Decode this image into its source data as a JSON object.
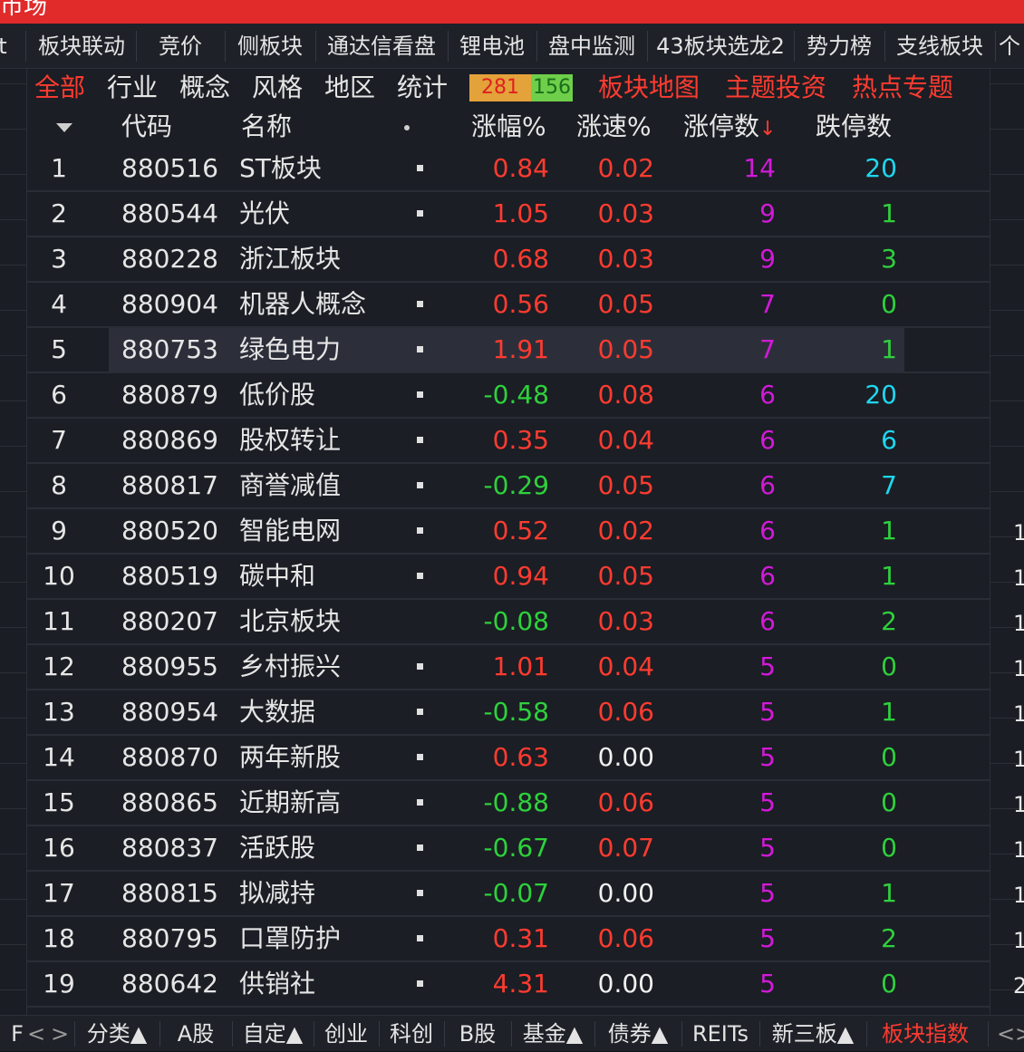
{
  "window": {
    "title": "市场"
  },
  "top_tabs": [
    {
      "label": "t"
    },
    {
      "label": "板块联动"
    },
    {
      "label": "竞价"
    },
    {
      "label": "侧板块"
    },
    {
      "label": "通达信看盘"
    },
    {
      "label": "锂电池"
    },
    {
      "label": "盘中监测"
    },
    {
      "label": "43板块选龙2"
    },
    {
      "label": "势力榜"
    },
    {
      "label": "支线板块"
    },
    {
      "label": "个"
    }
  ],
  "filters": [
    {
      "label": "全部",
      "active": true
    },
    {
      "label": "行业",
      "active": false
    },
    {
      "label": "概念",
      "active": false
    },
    {
      "label": "风格",
      "active": false
    },
    {
      "label": "地区",
      "active": false
    },
    {
      "label": "统计",
      "active": false
    }
  ],
  "counter": {
    "up": "281",
    "down": "156"
  },
  "hot_links": [
    {
      "label": "板块地图"
    },
    {
      "label": "主题投资"
    },
    {
      "label": "热点专题"
    }
  ],
  "columns": {
    "code": "代码",
    "name": "名称",
    "pct": "涨幅%",
    "speed": "涨速%",
    "limit_up": "涨停数",
    "limit_up_sort": "↓",
    "limit_down": "跌停数"
  },
  "rows": [
    {
      "idx": "1",
      "code": "880516",
      "name": "ST板块",
      "mark": true,
      "pct": "0.84",
      "pct_color": "red",
      "speed": "0.02",
      "speed_color": "red",
      "limit_up": "14",
      "limit_down": "20",
      "dn_color": "cyan"
    },
    {
      "idx": "2",
      "code": "880544",
      "name": "光伏",
      "mark": true,
      "pct": "1.05",
      "pct_color": "red",
      "speed": "0.03",
      "speed_color": "red",
      "limit_up": "9",
      "limit_down": "1",
      "dn_color": "green"
    },
    {
      "idx": "3",
      "code": "880228",
      "name": "浙江板块",
      "mark": false,
      "pct": "0.68",
      "pct_color": "red",
      "speed": "0.03",
      "speed_color": "red",
      "limit_up": "9",
      "limit_down": "3",
      "dn_color": "green"
    },
    {
      "idx": "4",
      "code": "880904",
      "name": "机器人概念",
      "mark": true,
      "pct": "0.56",
      "pct_color": "red",
      "speed": "0.05",
      "speed_color": "red",
      "limit_up": "7",
      "limit_down": "0",
      "dn_color": "green"
    },
    {
      "idx": "5",
      "code": "880753",
      "name": "绿色电力",
      "mark": true,
      "pct": "1.91",
      "pct_color": "red",
      "speed": "0.05",
      "speed_color": "red",
      "limit_up": "7",
      "limit_down": "1",
      "dn_color": "green",
      "selected": true
    },
    {
      "idx": "6",
      "code": "880879",
      "name": "低价股",
      "mark": true,
      "pct": "-0.48",
      "pct_color": "green",
      "speed": "0.08",
      "speed_color": "red",
      "limit_up": "6",
      "limit_down": "20",
      "dn_color": "cyan"
    },
    {
      "idx": "7",
      "code": "880869",
      "name": "股权转让",
      "mark": true,
      "pct": "0.35",
      "pct_color": "red",
      "speed": "0.04",
      "speed_color": "red",
      "limit_up": "6",
      "limit_down": "6",
      "dn_color": "cyan"
    },
    {
      "idx": "8",
      "code": "880817",
      "name": "商誉减值",
      "mark": true,
      "pct": "-0.29",
      "pct_color": "green",
      "speed": "0.05",
      "speed_color": "red",
      "limit_up": "6",
      "limit_down": "7",
      "dn_color": "cyan"
    },
    {
      "idx": "9",
      "code": "880520",
      "name": "智能电网",
      "mark": true,
      "pct": "0.52",
      "pct_color": "red",
      "speed": "0.02",
      "speed_color": "red",
      "limit_up": "6",
      "limit_down": "1",
      "dn_color": "green"
    },
    {
      "idx": "10",
      "code": "880519",
      "name": "碳中和",
      "mark": true,
      "pct": "0.94",
      "pct_color": "red",
      "speed": "0.05",
      "speed_color": "red",
      "limit_up": "6",
      "limit_down": "1",
      "dn_color": "green"
    },
    {
      "idx": "11",
      "code": "880207",
      "name": "北京板块",
      "mark": false,
      "pct": "-0.08",
      "pct_color": "green",
      "speed": "0.03",
      "speed_color": "red",
      "limit_up": "6",
      "limit_down": "2",
      "dn_color": "green"
    },
    {
      "idx": "12",
      "code": "880955",
      "name": "乡村振兴",
      "mark": true,
      "pct": "1.01",
      "pct_color": "red",
      "speed": "0.04",
      "speed_color": "red",
      "limit_up": "5",
      "limit_down": "0",
      "dn_color": "green"
    },
    {
      "idx": "13",
      "code": "880954",
      "name": "大数据",
      "mark": true,
      "pct": "-0.58",
      "pct_color": "green",
      "speed": "0.06",
      "speed_color": "red",
      "limit_up": "5",
      "limit_down": "1",
      "dn_color": "green"
    },
    {
      "idx": "14",
      "code": "880870",
      "name": "两年新股",
      "mark": true,
      "pct": "0.63",
      "pct_color": "red",
      "speed": "0.00",
      "speed_color": "white",
      "limit_up": "5",
      "limit_down": "0",
      "dn_color": "green"
    },
    {
      "idx": "15",
      "code": "880865",
      "name": "近期新高",
      "mark": true,
      "pct": "-0.88",
      "pct_color": "green",
      "speed": "0.06",
      "speed_color": "red",
      "limit_up": "5",
      "limit_down": "0",
      "dn_color": "green"
    },
    {
      "idx": "16",
      "code": "880837",
      "name": "活跃股",
      "mark": true,
      "pct": "-0.67",
      "pct_color": "green",
      "speed": "0.07",
      "speed_color": "red",
      "limit_up": "5",
      "limit_down": "0",
      "dn_color": "green"
    },
    {
      "idx": "17",
      "code": "880815",
      "name": "拟减持",
      "mark": true,
      "pct": "-0.07",
      "pct_color": "green",
      "speed": "0.00",
      "speed_color": "white",
      "limit_up": "5",
      "limit_down": "1",
      "dn_color": "green"
    },
    {
      "idx": "18",
      "code": "880795",
      "name": "口罩防护",
      "mark": true,
      "pct": "0.31",
      "pct_color": "red",
      "speed": "0.06",
      "speed_color": "red",
      "limit_up": "5",
      "limit_down": "2",
      "dn_color": "green"
    },
    {
      "idx": "19",
      "code": "880642",
      "name": "供销社",
      "mark": true,
      "pct": "4.31",
      "pct_color": "red",
      "speed": "0.00",
      "speed_color": "white",
      "limit_up": "5",
      "limit_down": "0",
      "dn_color": "green"
    }
  ],
  "right_digits": [
    "1",
    "1",
    "1",
    "1",
    "1",
    "1",
    "1",
    "1",
    "1",
    "1",
    "2"
  ],
  "bottom_tabs": [
    {
      "label": "分类▲",
      "active": false
    },
    {
      "label": "A股",
      "active": false
    },
    {
      "label": "自定▲",
      "active": false
    },
    {
      "label": "创业",
      "active": false
    },
    {
      "label": "科创",
      "active": false
    },
    {
      "label": "B股",
      "active": false
    },
    {
      "label": "基金▲",
      "active": false
    },
    {
      "label": "债券▲",
      "active": false
    },
    {
      "label": "REITs",
      "active": false
    },
    {
      "label": "新三板▲",
      "active": false
    },
    {
      "label": "板块指数",
      "active": true
    }
  ],
  "bottom_left_letter": "F",
  "nav": {
    "prev": "<",
    "next": ">"
  },
  "colors": {
    "up": "#ff3b30",
    "down": "#2ed13c",
    "limit_up": "#d21ad8",
    "limit_down_high": "#1ed7ef",
    "accent_bar": "#e12a2a"
  }
}
